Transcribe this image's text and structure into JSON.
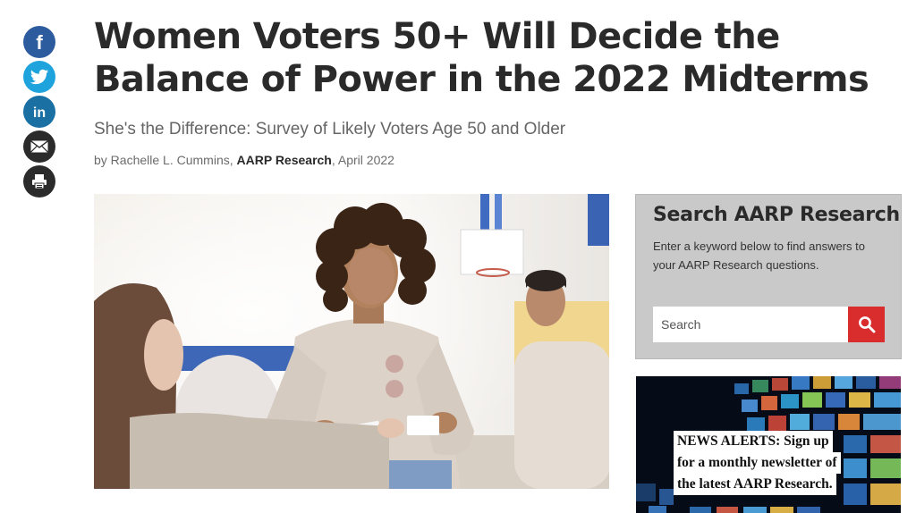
{
  "share": {
    "items": [
      {
        "name": "facebook",
        "icon": "facebook-icon",
        "color": "#2d5c9e"
      },
      {
        "name": "twitter",
        "icon": "twitter-bird-icon",
        "color": "#1ea3dd"
      },
      {
        "name": "linkedin",
        "icon": "linkedin-icon",
        "color": "#1a6fa3"
      },
      {
        "name": "email",
        "icon": "envelope-icon",
        "color": "#2b2b2b"
      },
      {
        "name": "print",
        "icon": "printer-icon",
        "color": "#2b2b2b"
      }
    ],
    "facebook_glyph": "f",
    "linkedin_glyph": "in"
  },
  "article": {
    "title": "Women Voters 50+ Will Decide the Balance of Power in the 2022 Midterms",
    "subtitle": "She's the Difference: Survey of Likely Voters Age 50 and Older",
    "byline_prefix": "by Rachelle L. Cummins, ",
    "byline_org": "AARP Research",
    "byline_suffix": ", April 2022",
    "hero_image": "photo-women-at-polling-place"
  },
  "search": {
    "title": "Search AARP Research",
    "help": "Enter a keyword below to find answers to your AARP Research questions.",
    "placeholder": "Search",
    "button_icon": "magnifier-icon",
    "button_color": "#d92c2c"
  },
  "news_alert": {
    "lines": [
      "NEWS ALERTS: Sign up",
      "for a monthly newsletter of",
      "the latest AARP Research."
    ],
    "background": "screens-wall-image"
  },
  "colors": {
    "headline": "#2a2a2a",
    "subtitle": "#666666",
    "search_panel": "#c9c9c9",
    "accent_red": "#d92c2c"
  }
}
